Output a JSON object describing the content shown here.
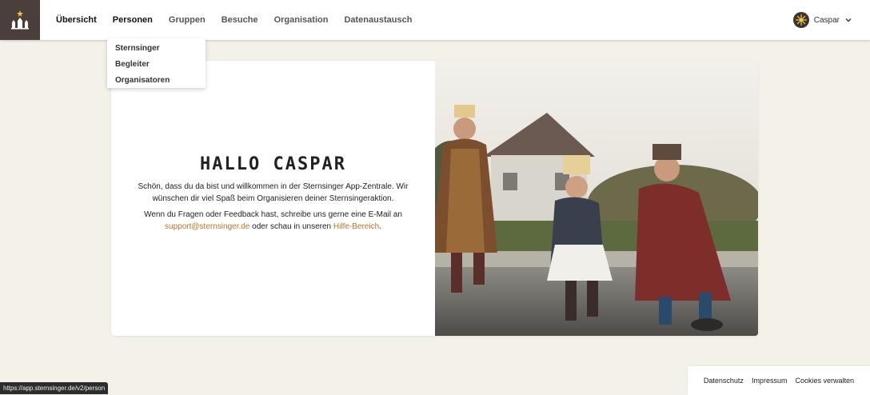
{
  "nav": {
    "items": [
      {
        "label": "Übersicht"
      },
      {
        "label": "Personen"
      },
      {
        "label": "Gruppen"
      },
      {
        "label": "Besuche"
      },
      {
        "label": "Organisation"
      },
      {
        "label": "Datenaustausch"
      }
    ]
  },
  "user": {
    "name": "Caspar"
  },
  "dropdown": {
    "items": [
      {
        "label": "Sternsinger"
      },
      {
        "label": "Begleiter"
      },
      {
        "label": "Organisatoren"
      }
    ]
  },
  "welcome": {
    "title": "HALLO CASPAR",
    "intro": "Schön, dass du da bist und willkommen in der Sternsinger App-Zentrale. Wir wünschen dir viel Spaß beim Organisieren deiner Sternsingeraktion.",
    "contact_prefix": "Wenn du Fragen oder Feedback hast, schreibe uns gerne eine E-Mail an",
    "email": "support@sternsinger.de",
    "contact_middle": "oder schau in unseren",
    "help_link": "Hilfe-Bereich",
    "contact_suffix": "."
  },
  "footer": {
    "links": [
      {
        "label": "Datenschutz"
      },
      {
        "label": "Impressum"
      },
      {
        "label": "Cookies verwalten"
      }
    ]
  },
  "status_url": "https://app.sternsinger.de/v2/person",
  "colors": {
    "background": "#f4f1e9",
    "logo_bg": "#4a3f3a",
    "link": "#b8752a"
  },
  "icons": {
    "logo": "three-kings-logo-icon",
    "avatar": "star-avatar-icon",
    "chevron": "chevron-down-icon"
  }
}
